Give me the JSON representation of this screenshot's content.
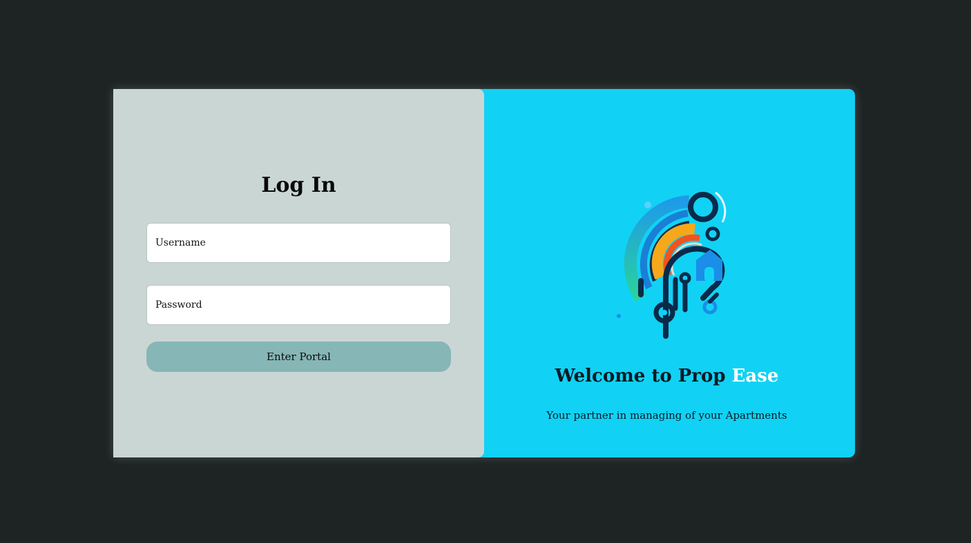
{
  "login": {
    "title": "Log In",
    "username_placeholder": "Username",
    "password_placeholder": "Password",
    "submit_label": "Enter Portal"
  },
  "brand": {
    "welcome_prefix": "Welcome to Prop ",
    "welcome_accent": "Ease",
    "tagline": "Your partner in managing of your Apartments",
    "logo_icon": "prop-ease-logo-icon"
  },
  "colors": {
    "background": "#1e2424",
    "left_panel": "#cad6d4",
    "right_panel": "#11d2f4",
    "button": "#86b6b6",
    "accent_text": "#ffffff"
  }
}
